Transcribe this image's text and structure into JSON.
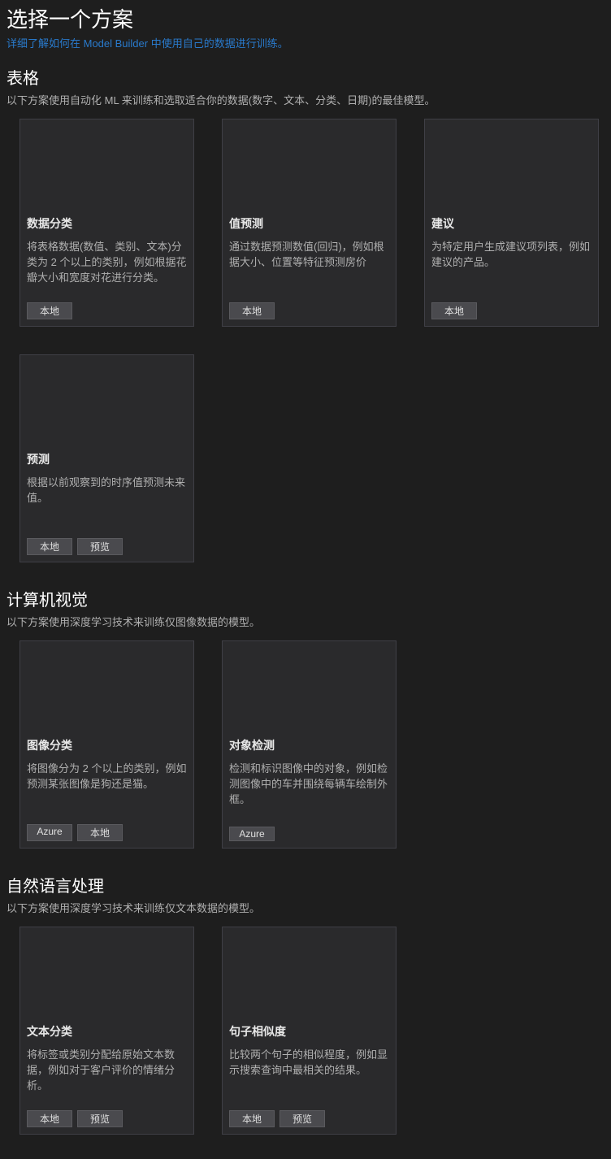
{
  "header": {
    "title": "选择一个方案",
    "subtitle_link": "详细了解如何在 Model Builder 中使用自己的数据进行训练。"
  },
  "sections": [
    {
      "title": "表格",
      "desc": "以下方案使用自动化 ML 来训练和选取适合你的数据(数字、文本、分类、日期)的最佳模型。",
      "cards": [
        {
          "title": "数据分类",
          "desc": "将表格数据(数值、类别、文本)分类为 2 个以上的类别，例如根据花瓣大小和宽度对花进行分类。",
          "tags": [
            "本地"
          ]
        },
        {
          "title": "值预测",
          "desc": "通过数据预测数值(回归)，例如根据大小、位置等特征预测房价",
          "tags": [
            "本地"
          ]
        },
        {
          "title": "建议",
          "desc": "为特定用户生成建议项列表，例如建议的产品。",
          "tags": [
            "本地"
          ]
        },
        {
          "title": "预测",
          "desc": "根据以前观察到的时序值预测未来值。",
          "tags": [
            "本地",
            "预览"
          ]
        }
      ]
    },
    {
      "title": "计算机视觉",
      "desc": "以下方案使用深度学习技术来训练仅图像数据的模型。",
      "cards": [
        {
          "title": "图像分类",
          "desc": "将图像分为 2 个以上的类别，例如预测某张图像是狗还是猫。",
          "tags": [
            "Azure",
            "本地"
          ]
        },
        {
          "title": "对象检测",
          "desc": "检测和标识图像中的对象，例如检测图像中的车并围绕每辆车绘制外框。",
          "tags": [
            "Azure"
          ]
        }
      ]
    },
    {
      "title": "自然语言处理",
      "desc": "以下方案使用深度学习技术来训练仅文本数据的模型。",
      "cards": [
        {
          "title": "文本分类",
          "desc": "将标签或类别分配给原始文本数据，例如对于客户评价的情绪分析。",
          "tags": [
            "本地",
            "预览"
          ]
        },
        {
          "title": "句子相似度",
          "desc": "比较两个句子的相似程度，例如显示搜索查询中最相关的结果。",
          "tags": [
            "本地",
            "预览"
          ]
        }
      ]
    }
  ]
}
